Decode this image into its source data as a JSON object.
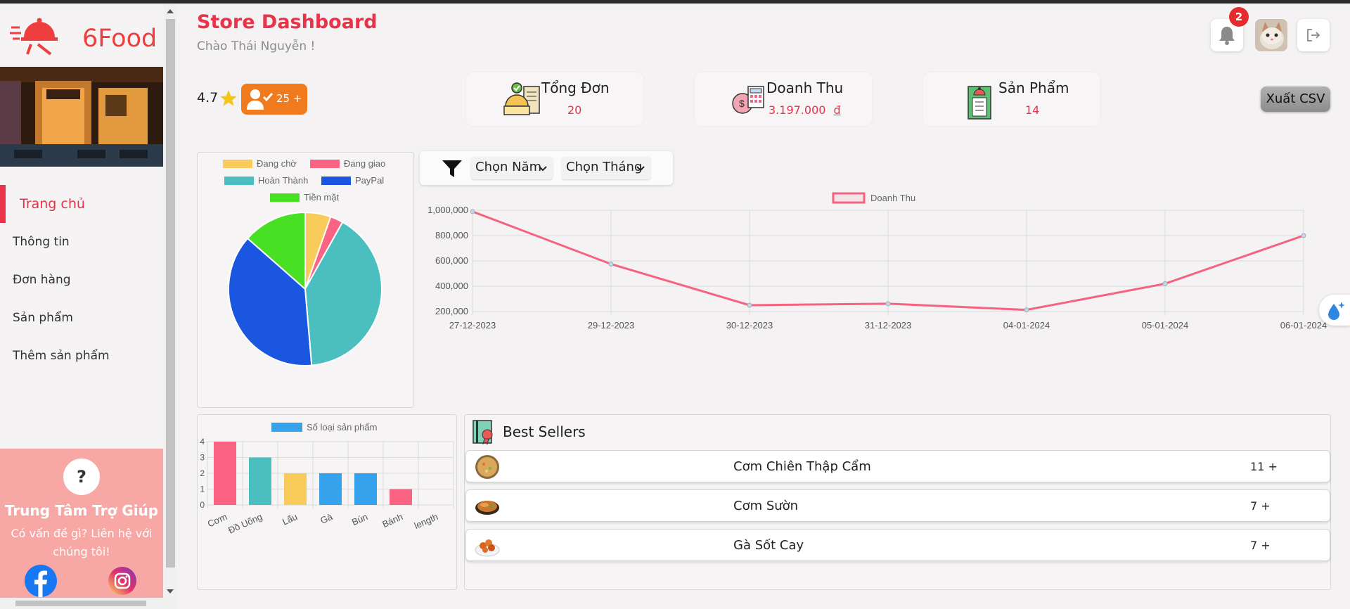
{
  "app": {
    "name": "6Food"
  },
  "header": {
    "title": "Store Dashboard",
    "greeting": "Chào Thái Nguyễn !",
    "notification_count": "2"
  },
  "store": {
    "rating": "4.7",
    "followers": "25 +"
  },
  "stats": [
    {
      "label": "Tổng Đơn",
      "value": "20",
      "icon": "order-icon"
    },
    {
      "label": "Doanh Thu",
      "value": "3.197.000",
      "unit": "đ",
      "icon": "revenue-icon"
    },
    {
      "label": "Sản Phẩm",
      "value": "14",
      "icon": "product-icon"
    }
  ],
  "export_label": "Xuất CSV",
  "sidebar": {
    "items": [
      {
        "label": "Trang chủ",
        "active": true
      },
      {
        "label": "Thông tin"
      },
      {
        "label": "Đơn hàng"
      },
      {
        "label": "Sản phẩm"
      },
      {
        "label": "Thêm sản phẩm"
      }
    ],
    "help": {
      "title": "Trung Tâm Trợ Giúp",
      "description": "Có vấn đề gì? Liên hệ với chúng tôi!"
    }
  },
  "filters": {
    "year": "Chọn Năm",
    "month": "Chọn Tháng"
  },
  "best_sellers": {
    "title": "Best Sellers",
    "items": [
      {
        "name": "Cơm Chiên Thập Cẩm",
        "qty": "11 +"
      },
      {
        "name": "Cơm Sườn",
        "qty": "7 +"
      },
      {
        "name": "Gà Sốt Cay",
        "qty": "7 +"
      }
    ]
  },
  "colors": {
    "accent": "#e8334a",
    "line": "#f5637f",
    "pie_waiting": "#f9cb5b",
    "pie_shipping": "#fb6384",
    "pie_done": "#4bbfbf",
    "pie_paypal": "#1a56e0",
    "pie_cash": "#47e023",
    "bar_blue": "#36a2eb"
  },
  "chart_data": [
    {
      "type": "pie",
      "labels": [
        "Đang chờ",
        "Đang giao",
        "Hoàn Thành",
        "PayPal",
        "Tiền mặt"
      ],
      "values": [
        1,
        0.5,
        7.5,
        7,
        2.5
      ],
      "colors": [
        "#f9cb5b",
        "#fb6384",
        "#4bbfbf",
        "#1a56e0",
        "#47e023"
      ],
      "legend": "top"
    },
    {
      "type": "line",
      "series": [
        {
          "name": "Doanh Thu",
          "values": [
            990000,
            575000,
            250000,
            262000,
            213000,
            420000,
            800000
          ]
        }
      ],
      "x": [
        "27-12-2023",
        "29-12-2023",
        "30-12-2023",
        "31-12-2023",
        "04-01-2024",
        "05-01-2024",
        "06-01-2024"
      ],
      "yticks": [
        "1,000,000",
        "800,000",
        "600,000",
        "400,000",
        "200,000"
      ],
      "ylim": [
        200000,
        1000000
      ],
      "legend": "top",
      "grid": true
    },
    {
      "type": "bar",
      "series": [
        {
          "name": "Số loại sản phẩm",
          "values": [
            4,
            3,
            2,
            2,
            2,
            1
          ]
        }
      ],
      "categories": [
        "Cơm",
        "Đồ Uống",
        "Lẩu",
        "Gà",
        "Bún",
        "Bánh",
        "length"
      ],
      "colors": [
        "#fb6384",
        "#4bbfbf",
        "#f9cb5b",
        "#36a2eb",
        "#36a2eb",
        "#fb6384"
      ],
      "yticks": [
        "4",
        "3",
        "2",
        "1",
        "0"
      ],
      "ylim": [
        0,
        4
      ],
      "grid": true,
      "legend": "top"
    }
  ]
}
